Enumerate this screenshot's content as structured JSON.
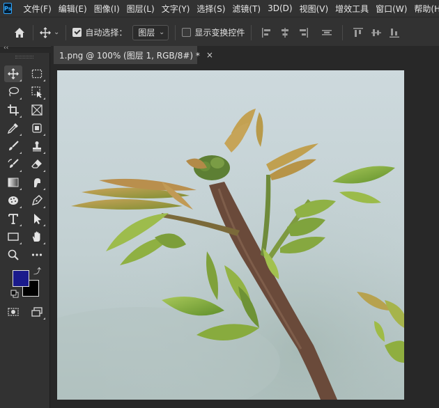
{
  "menubar": {
    "logo": "Ps",
    "items": [
      "文件(F)",
      "编辑(E)",
      "图像(I)",
      "图层(L)",
      "文字(Y)",
      "选择(S)",
      "滤镜(T)",
      "3D(D)",
      "视图(V)",
      "增效工具",
      "窗口(W)",
      "帮助(H)"
    ]
  },
  "options": {
    "auto_select_label": "自动选择：",
    "auto_select_checked": true,
    "auto_select_value": "图层",
    "show_transform_label": "显示变换控件",
    "show_transform_checked": false
  },
  "panel": {
    "collapse_glyph": "‹‹"
  },
  "document": {
    "tab_title": "1.png @ 100% (图层 1, RGB/8#) *",
    "close_glyph": "×"
  },
  "colors": {
    "foreground": "#1a1a8c",
    "background": "#000000",
    "accent": "#31a8ff"
  },
  "icons": {
    "swap": "⤴"
  }
}
